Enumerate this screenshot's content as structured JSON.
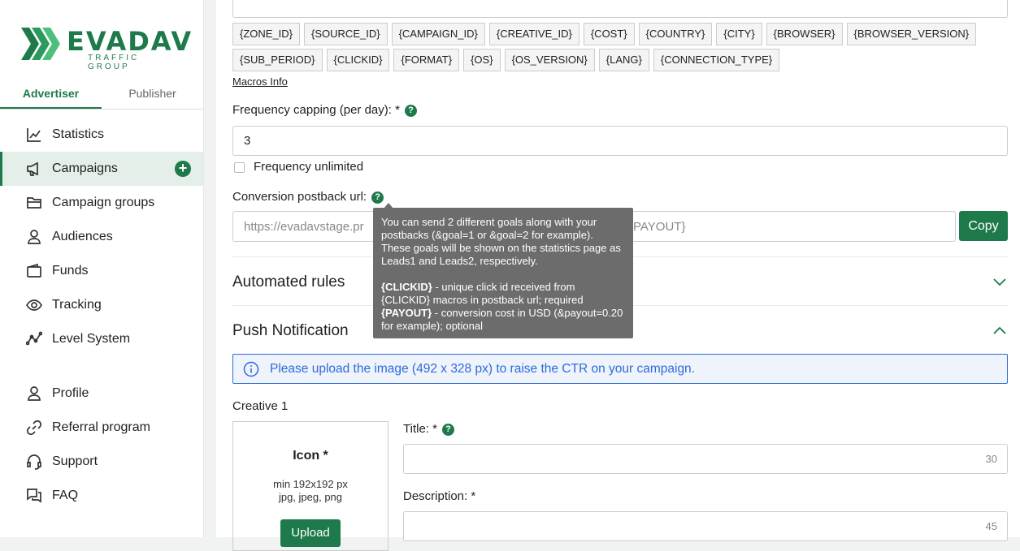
{
  "brand": {
    "name": "EVADAV",
    "tagline": "TRAFFIC GROUP",
    "color": "#1e7a4a"
  },
  "tabs": [
    {
      "label": "Advertiser",
      "active": true
    },
    {
      "label": "Publisher",
      "active": false
    }
  ],
  "nav": {
    "items": [
      {
        "label": "Statistics",
        "icon": "chart-icon"
      },
      {
        "label": "Campaigns",
        "icon": "megaphone-icon"
      },
      {
        "label": "Campaign groups",
        "icon": "folder-icon"
      },
      {
        "label": "Audiences",
        "icon": "users-icon"
      },
      {
        "label": "Funds",
        "icon": "wallet-icon"
      },
      {
        "label": "Tracking",
        "icon": "eye-icon"
      },
      {
        "label": "Level System",
        "icon": "graph-icon"
      }
    ],
    "secondary": [
      {
        "label": "Profile",
        "icon": "user-icon"
      },
      {
        "label": "Referral program",
        "icon": "link-icon"
      },
      {
        "label": "Support",
        "icon": "headset-icon"
      },
      {
        "label": "FAQ",
        "icon": "chat-icon"
      }
    ],
    "add_symbol": "+"
  },
  "macros": [
    "{ZONE_ID}",
    "{SOURCE_ID}",
    "{CAMPAIGN_ID}",
    "{CREATIVE_ID}",
    "{COST}",
    "{COUNTRY}",
    "{CITY}",
    "{BROWSER}",
    "{BROWSER_VERSION}",
    "{SUB_PERIOD}",
    "{CLICKID}",
    "{FORMAT}",
    "{OS}",
    "{OS_VERSION}",
    "{LANG}",
    "{CONNECTION_TYPE}"
  ],
  "macros_info": "Macros Info",
  "frequency": {
    "label": "Frequency capping (per day): *",
    "value": "3",
    "unlimited_label": "Frequency unlimited",
    "help": "?"
  },
  "postback": {
    "label": "Conversion postback url:",
    "placeholder_start": "https://evadavstage.pr",
    "placeholder_end": "PAYOUT}",
    "copy_label": "Copy",
    "help": "?"
  },
  "tooltip": {
    "p1": "You can send 2 different goals along with your postbacks (&goal=1 or &goal=2 for example). These goals will be shown on the statistics page as Leads1 and Leads2, respectively.",
    "clickid_key": "{CLICKID}",
    "clickid_text": " - unique click id received from {CLICKID} macros in postback url; required",
    "payout_key": "{PAYOUT}",
    "payout_text": " - conversion cost in USD (&payout=0.20 for example); optional"
  },
  "sections": {
    "automated_rules": "Automated rules",
    "push_notification": "Push Notification"
  },
  "info_box": "Please upload the image (492 x 328 px) to raise the CTR on your campaign.",
  "creative": {
    "title": "Creative 1",
    "icon_label": "Icon *",
    "icon_size": "min 192x192 px",
    "icon_formats": "jpg, jpeg, png",
    "upload_label": "Upload",
    "title_label": "Title: *",
    "title_counter": "30",
    "description_label": "Description: *",
    "description_counter": "45",
    "help": "?"
  }
}
